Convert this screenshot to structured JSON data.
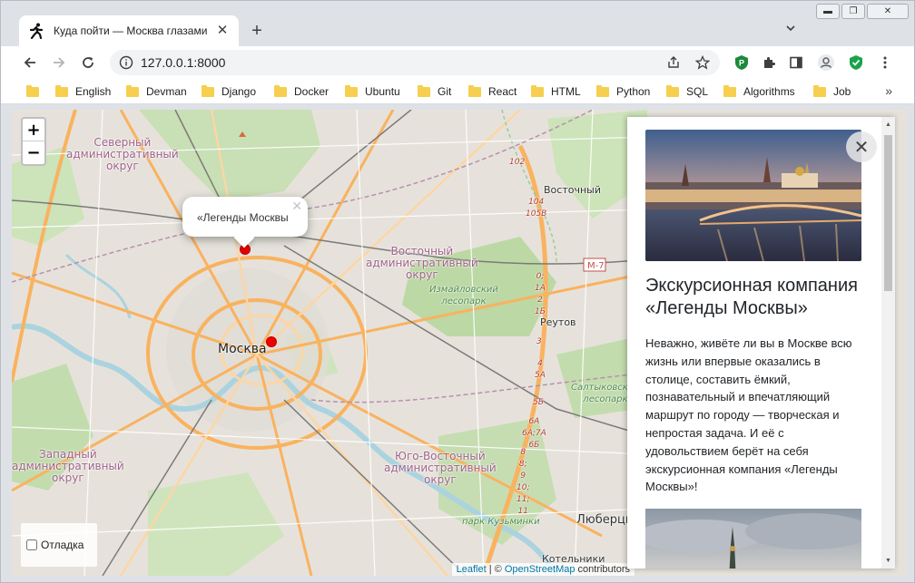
{
  "window": {
    "controls": {
      "minimize": "▬",
      "maximize": "❐",
      "close": "✕"
    }
  },
  "tab": {
    "title": "Куда пойти — Москва глазами экскурсовода",
    "icon": "walking-person-icon",
    "close": "✕",
    "new_tab": "+"
  },
  "toolbar": {
    "url": "127.0.0.1:8000",
    "icons": [
      "back-icon",
      "forward-icon",
      "reload-icon",
      "info-icon",
      "share-icon",
      "star-icon",
      "extension-p-icon",
      "puzzle-icon",
      "sidepanel-icon",
      "profile-icon",
      "shield-icon",
      "menu-icon"
    ]
  },
  "bookmarks": {
    "items": [
      {
        "label": ""
      },
      {
        "label": "English"
      },
      {
        "label": "Devman"
      },
      {
        "label": "Django"
      },
      {
        "label": "Docker"
      },
      {
        "label": "Ubuntu"
      },
      {
        "label": "Git"
      },
      {
        "label": "React"
      },
      {
        "label": "HTML"
      },
      {
        "label": "Python"
      },
      {
        "label": "SQL"
      },
      {
        "label": "Algorithms"
      },
      {
        "label": "Job"
      }
    ],
    "more": "»"
  },
  "map": {
    "zoom_in": "+",
    "zoom_out": "−",
    "popup": {
      "text": "«Легенды Москвы",
      "close": "✕"
    },
    "labels": {
      "north": "Северный\nадминистративный\nокруг",
      "east": "Восточный\nадминистративный\nокруг",
      "west": "Западный\nадминистративный\nокруг",
      "southeast": "Юго-Восточный\nадминистративный\nокруг",
      "moscow": "Москва",
      "izmailovo": "Измайловский\nлесопарк",
      "saltykovsky": "Салтыковский\nлесопарк",
      "kuzminki": "парк Кузьминки",
      "vostochny": "Восточный",
      "reutov": "Реутов",
      "lyubertsy": "Люберцы",
      "kotelniki": "Котельники",
      "m7": "М-7",
      "km102": "102",
      "km104": "104\n105В",
      "mkad_east": "0;\n1А\n2\n1Б",
      "mkad_3": "3",
      "mkad_4": "4\n5А",
      "mkad_5b": "5Б",
      "mkad_6": "6А\n6А;7А\n6Б",
      "mkad_8": "8\n8;\n9\n10;\n11;\n11"
    },
    "debug_label": "Отладка",
    "attribution": {
      "leaflet": "Leaflet",
      "sep": " | © ",
      "osm": "OpenStreetMap",
      "contrib": " contributors"
    }
  },
  "panel": {
    "close": "✕",
    "title": "Экскурсионная компания «Легенды Москвы»",
    "text": "Неважно, живёте ли вы в Москве всю жизнь или впервые оказались в столице, составить ёмкий, познавательный и впечатляющий маршрут по городу — творческая и непростая задача. И её с удовольствием берёт на себя экскурсионная компания «Легенды Москвы»!"
  },
  "colors": {
    "marker": "#ee0000",
    "link": "#0078a8",
    "district_label": "#a0628a",
    "road_major": "#f9b25f",
    "road_minor": "#ffffff",
    "park": "#c8dfb3",
    "water": "#aad3df",
    "urban": "#e3e0dc",
    "rail": "#888888"
  }
}
